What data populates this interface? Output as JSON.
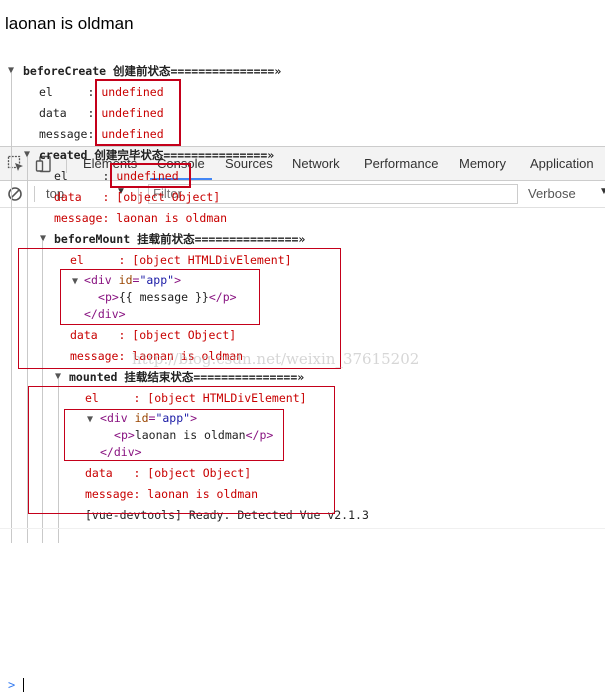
{
  "page": {
    "text": "laonan is oldman"
  },
  "devtools": {
    "tabs": [
      "Elements",
      "Console",
      "Sources",
      "Network",
      "Performance",
      "Memory",
      "Application"
    ],
    "active_tab": "Console",
    "icons": [
      "inspect-element-icon",
      "device-toolbar-icon",
      "clear-console-icon"
    ],
    "context": "top",
    "filter_placeholder": "Filter",
    "level": "Verbose"
  },
  "console": {
    "beforeCreate": {
      "header": "beforeCreate 创建前状态===============»",
      "el_key": "el     : ",
      "el_val": "undefined",
      "data_key": "data   : ",
      "data_val": "undefined",
      "message_key": "message: ",
      "message_val": "undefined"
    },
    "created": {
      "header": "created 创建完毕状态===============»",
      "el_key": "el     : ",
      "el_val": "undefined",
      "data_line": "data   : [object Object]",
      "message_line": "message: laonan is oldman"
    },
    "beforeMount": {
      "header": "beforeMount 挂载前状态===============»",
      "el_line": "el     : [object HTMLDivElement]",
      "dom_open_tag": "div",
      "dom_attr_name": "id",
      "dom_attr_value": "\"app\"",
      "dom_inner_tag": "p",
      "dom_inner_text": "{{ message }}",
      "data_line": "data   : [object Object]",
      "message_line": "message: laonan is oldman"
    },
    "mounted": {
      "header": "mounted 挂载结束状态===============»",
      "el_line": "el     : [object HTMLDivElement]",
      "dom_open_tag": "div",
      "dom_attr_name": "id",
      "dom_attr_value": "\"app\"",
      "dom_inner_tag": "p",
      "dom_inner_text": "laonan is oldman",
      "data_line": "data   : [object Object]",
      "message_line": "message: laonan is oldman"
    },
    "devtools_line": "[vue-devtools] Ready. Detected Vue v2.1.3",
    "prompt": ">"
  },
  "watermark": "http://blog.csdn.net/weixin_37615202",
  "colors": {
    "error_red": "#c80000",
    "highlight_box": "#c4001a",
    "active_tab_underline": "#4285f4"
  }
}
